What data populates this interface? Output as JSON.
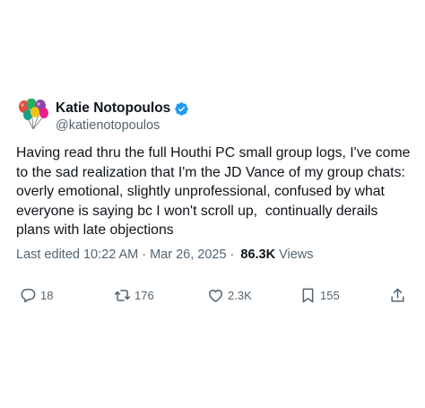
{
  "author": {
    "display_name": "Katie Notopoulos",
    "handle": "@katienotopoulos",
    "avatar_icon": "balloons-avatar",
    "verified_icon": "verified-badge-icon",
    "verified_color": "#1d9bf0"
  },
  "tweet": {
    "text": "Having read thru the full Houthi PC small group logs, I've come to the sad realization that I'm the JD Vance of my group chats: overly emotional, slightly unprofessional, confused by what everyone is saying bc I won't scroll up,  continually derails plans with late objections"
  },
  "meta": {
    "edited_time": "Last edited 10:22 AM",
    "separator": "·",
    "date": "Mar 26, 2025",
    "views_count": "86.3K",
    "views_label": "Views"
  },
  "actions": {
    "replies": "18",
    "retweets": "176",
    "likes": "2.3K",
    "bookmarks": "155"
  },
  "colors": {
    "text": "#0f1419",
    "secondary": "#536471",
    "accent": "#1d9bf0"
  }
}
